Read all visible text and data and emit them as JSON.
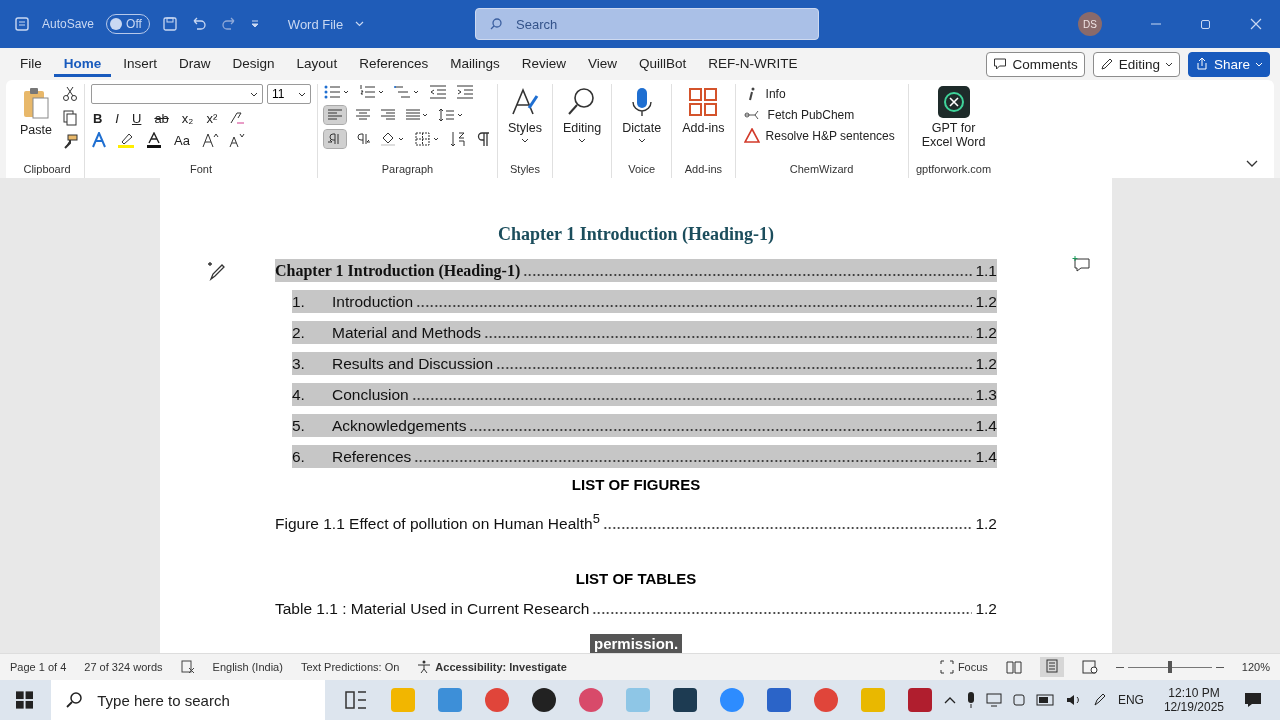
{
  "title_bar": {
    "autosave_label": "AutoSave",
    "autosave": {
      "on": false,
      "label": "Off"
    },
    "doc_title": "Word File",
    "search": {
      "placeholder": "Search"
    },
    "avatar": "DS"
  },
  "tabs": [
    {
      "label": "File",
      "selected": false
    },
    {
      "label": "Home",
      "selected": true
    },
    {
      "label": "Insert",
      "selected": false
    },
    {
      "label": "Draw",
      "selected": false
    },
    {
      "label": "Design",
      "selected": false
    },
    {
      "label": "Layout",
      "selected": false
    },
    {
      "label": "References",
      "selected": false
    },
    {
      "label": "Mailings",
      "selected": false
    },
    {
      "label": "Review",
      "selected": false
    },
    {
      "label": "View",
      "selected": false
    },
    {
      "label": "QuillBot",
      "selected": false
    },
    {
      "label": "REF-N-WRITE",
      "selected": false
    }
  ],
  "tab_actions": {
    "comments": "Comments",
    "editing": "Editing",
    "share": "Share"
  },
  "ribbon": {
    "clipboard": {
      "paste": "Paste",
      "label": "Clipboard"
    },
    "font": {
      "size": "11",
      "label": "Font",
      "row1": [
        "B",
        "I",
        "U",
        "ab",
        "x₂",
        "x²"
      ],
      "case": "Aa"
    },
    "paragraph": {
      "label": "Paragraph",
      "align_left_selected": true,
      "ltr_selected": true
    },
    "styles": {
      "button": "Styles",
      "label": "Styles"
    },
    "editing": {
      "button": "Editing"
    },
    "voice": {
      "button": "Dictate",
      "label": "Voice"
    },
    "addins": {
      "button": "Add-ins",
      "label": "Add-ins"
    },
    "chemwizard": {
      "items": [
        {
          "kind": "info",
          "label": "Info"
        },
        {
          "kind": "fetch",
          "label": "Fetch PubChem"
        },
        {
          "kind": "warning",
          "label": "Resolve H&P sentences"
        }
      ],
      "label": "ChemWizard"
    },
    "gpt": {
      "button": "GPT for Excel Word",
      "label": "gptforwork.com"
    }
  },
  "document": {
    "heading": "Chapter 1 Introduction (Heading-1)",
    "toc": {
      "text": "Chapter 1 Introduction (Heading-1)",
      "page": "1.1",
      "highlighted": true,
      "children": [
        {
          "number": "1.",
          "text": "Introduction",
          "page": "1.2",
          "highlighted": true
        },
        {
          "number": "2.",
          "text": "Material and Methods",
          "page": "1.2",
          "highlighted": true
        },
        {
          "number": "3.",
          "text": "Results and Discussion",
          "page": "1.2",
          "highlighted": true
        },
        {
          "number": "4.",
          "text": "Conclusion",
          "page": "1.3",
          "highlighted": true
        },
        {
          "number": "5.",
          "text": "Acknowledgements",
          "page": "1.4",
          "highlighted": true
        },
        {
          "number": "6.",
          "text": "References",
          "page": "1.4",
          "highlighted": true
        }
      ]
    },
    "figures_heading": "LIST OF FIGURES",
    "figures": [
      {
        "text": "Figure 1.1 Effect of pollution on Human Health$^{5}$",
        "page": "1.2"
      }
    ],
    "tables_heading": "LIST OF TABLES",
    "tables": [
      {
        "text": "Table 1.1 : Material Used in Current Research",
        "page": "1.2"
      }
    ]
  },
  "caption": "permission.",
  "status_bar": {
    "page": "Page 1 of 4",
    "words": "27 of 324 words",
    "language": "English (India)",
    "predictions": "Text Predictions: On",
    "accessibility": "Accessibility: Investigate",
    "focus": "Focus",
    "zoom": {
      "level": 0.5,
      "label": "120%"
    }
  },
  "taskbar": {
    "search": {
      "placeholder": "Type here to search"
    },
    "language": "ENG",
    "time": "12:10 PM",
    "date": "12/19/2025"
  }
}
